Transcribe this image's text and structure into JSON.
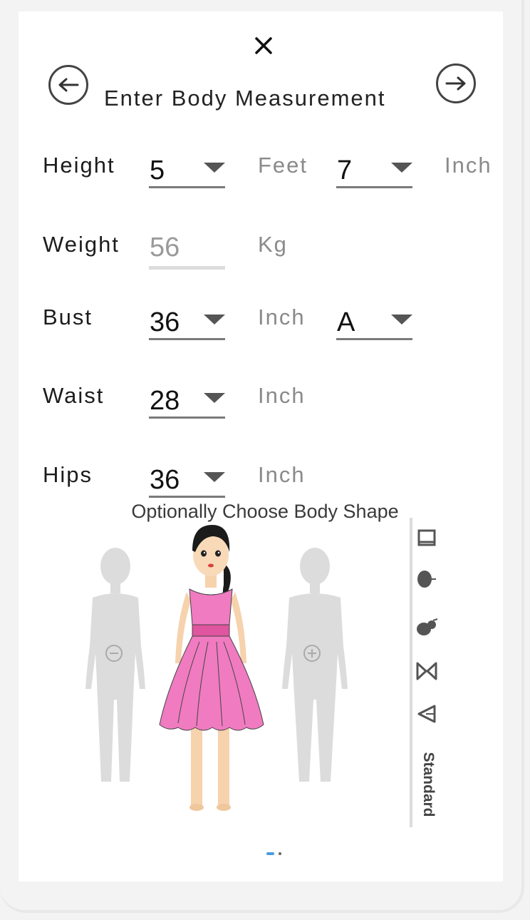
{
  "dialog": {
    "title": "Enter Body Measurement",
    "close_glyph": "✕",
    "prev_icon": "arrow-left-icon",
    "next_icon": "arrow-right-icon"
  },
  "fields": {
    "height": {
      "label": "Height",
      "feet_value": "5",
      "feet_unit": "Feet",
      "inch_value": "7",
      "inch_unit": "Inch"
    },
    "weight": {
      "label": "Weight",
      "placeholder": "56",
      "unit": "Kg"
    },
    "bust": {
      "label": "Bust",
      "value": "36",
      "unit": "Inch",
      "cup_value": "A"
    },
    "waist": {
      "label": "Waist",
      "value": "28",
      "unit": "Inch"
    },
    "hips": {
      "label": "Hips",
      "value": "36",
      "unit": "Inch"
    }
  },
  "body_shape": {
    "subtitle": "Optionally Choose Body Shape",
    "decrease_icon": "minus-circle-icon",
    "increase_icon": "plus-circle-icon",
    "shape_icons": [
      "rectangle-shape-icon",
      "apple-shape-icon",
      "pear-shape-icon",
      "hourglass-shape-icon",
      "inverted-triangle-shape-icon"
    ],
    "selected_shape": "Standard"
  },
  "colors": {
    "dress": "#f07bc0",
    "waistband": "#e0559f",
    "silhouette": "#d9d9d9",
    "accent": "#4a9be0"
  },
  "pagination": {
    "pages": 2,
    "active": 1
  }
}
